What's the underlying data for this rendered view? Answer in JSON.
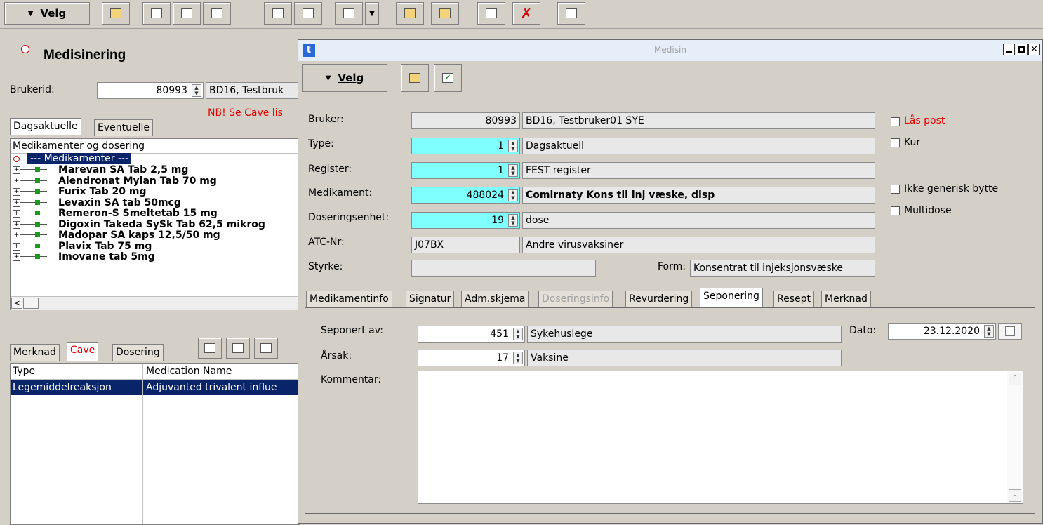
{
  "toolbar": {
    "velg_label": "Velg"
  },
  "main": {
    "title": "Medisinering",
    "brukerid_label": "Brukerid:",
    "brukerid_value": "80993",
    "brukerid_name": "BD16, Testbruk",
    "nb_text": "NB! Se Cave lis",
    "tabs": [
      "Dagsaktuelle",
      "Eventuelle"
    ],
    "tree_header": "Medikamenter og dosering",
    "tree_root": "--- Medikamenter ---",
    "tree_items": [
      "Marevan SA Tab 2,5 mg",
      "Alendronat Mylan Tab 70 mg",
      "Furix Tab 20 mg",
      "Levaxin SA tab  50mcg",
      "Remeron-S Smeltetab 15 mg",
      "Digoxin Takeda SySk Tab 62,5 mikrog",
      "Madopar SA kaps 12,5/50 mg",
      "Plavix Tab 75 mg",
      "Imovane tab 5mg"
    ],
    "scroll_left": "<",
    "bottom_tabs": [
      "Merknad",
      "Cave",
      "Dosering"
    ],
    "table_headers": [
      "Type",
      "Medication Name"
    ],
    "table_rows": [
      {
        "type": "Legemiddelreaksjon",
        "name": "Adjuvanted trivalent influe"
      }
    ]
  },
  "dialog": {
    "app_icon": "t",
    "title": "Medisin",
    "velg_label": "Velg",
    "bruker_label": "Bruker:",
    "bruker_value": "80993",
    "bruker_name": "BD16, Testbruker01 SYE",
    "type_label": "Type:",
    "type_value": "1",
    "type_text": "Dagsaktuell",
    "register_label": "Register:",
    "register_value": "1",
    "register_text": "FEST register",
    "medikament_label": "Medikament:",
    "medikament_value": "488024",
    "medikament_text": "Comirnaty Kons til inj væske, disp",
    "dosering_label": "Doseringsenhet:",
    "dosering_value": "19",
    "dosering_text": "dose",
    "atc_label": "ATC-Nr:",
    "atc_value": "J07BX",
    "atc_text": "Andre virusvaksiner",
    "styrke_label": "Styrke:",
    "styrke_value": "",
    "form_label": "Form:",
    "form_value": "Konsentrat til injeksjonsvæske",
    "checks": {
      "las_post": "Lås post",
      "kur": "Kur",
      "ikke_generisk": "Ikke generisk bytte",
      "multidose": "Multidose"
    },
    "tabs": [
      "Medikamentinfo",
      "Signatur",
      "Adm.skjema",
      "Doseringsinfo",
      "Revurdering",
      "Seponering",
      "Resept",
      "Merknad"
    ],
    "seponering": {
      "seponert_label": "Seponert av:",
      "seponert_value": "451",
      "seponert_text": "Sykehuslege",
      "dato_label": "Dato:",
      "dato_value": "23.12.2020",
      "arsak_label": "Årsak:",
      "arsak_value": "17",
      "arsak_text": "Vaksine",
      "kommentar_label": "Kommentar:",
      "kommentar_value": ""
    }
  },
  "colors": {
    "accent_red": "#e00000",
    "selection": "#0a246a",
    "cyan_field": "#80ffff"
  }
}
